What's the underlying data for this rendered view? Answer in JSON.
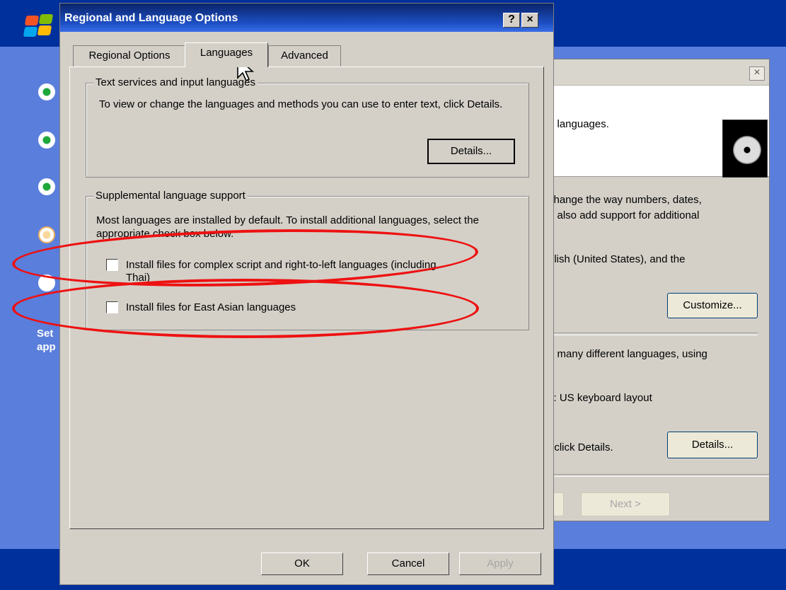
{
  "setup": {
    "side_text_line1": "Set",
    "side_text_line2": "app"
  },
  "wizard": {
    "close_glyph": "×",
    "header_text": "d languages.",
    "para1_line1": "change the way numbers, dates,",
    "para1_line2": "n also add support for additional",
    "para2": "glish (United States), and the",
    "customize_label": "Customize...",
    "para3": "n many different languages, using",
    "keyboard_text": "s: US keyboard layout",
    "details_text": ". click Details.",
    "details_label": "Details...",
    "next_label": "Next >"
  },
  "dialog": {
    "title": "Regional and Language Options",
    "help_glyph": "?",
    "close_glyph": "×",
    "tabs": [
      {
        "label": "Regional Options"
      },
      {
        "label": "Languages"
      },
      {
        "label": "Advanced"
      }
    ],
    "text_services": {
      "legend": "Text services and input languages",
      "description": "To view or change the languages and methods you can use to enter text, click Details.",
      "details_label": "Details..."
    },
    "supplemental": {
      "legend": "Supplemental language support",
      "description": "Most languages are installed by default. To install additional languages, select the appropriate check box below.",
      "option_complex_line1": "Install files for complex script and right-to-left languages (including",
      "option_complex_line2": "Thai)",
      "option_complex_checked": false,
      "option_east_asian": "Install files for East Asian languages",
      "option_east_asian_checked": false
    },
    "footer": {
      "ok_label": "OK",
      "cancel_label": "Cancel",
      "apply_label": "Apply"
    }
  },
  "colors": {
    "annotation": "#ee1111",
    "title_bar": "#0a246a",
    "setup_blue": "#5a7edc"
  }
}
